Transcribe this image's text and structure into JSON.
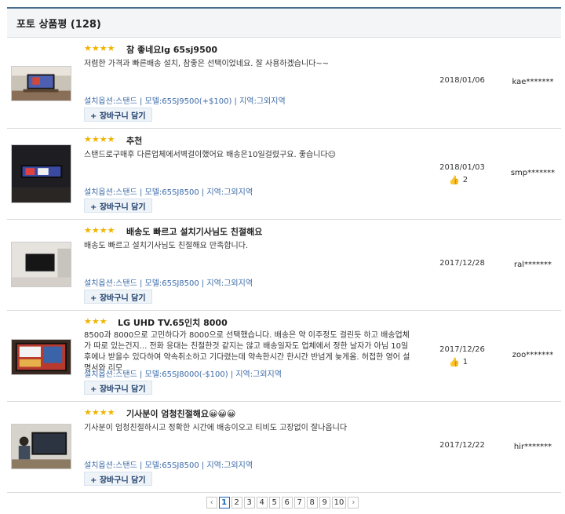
{
  "header": {
    "title": "포토 상품평 (128)"
  },
  "cart_label": "+ 장바구니 담기",
  "reviews": [
    {
      "stars": 4,
      "title": "참 좋네요lg 65sj9500",
      "body": "저렴한 가격과 빠른배송 설치, 참좋은 선택이었네요. 잘 사용하겠습니다~~",
      "options": "설치옵션:스탠드 | 모델:65SJ9500(+$100) | 지역:그외지역",
      "date": "2018/01/06",
      "likes": "",
      "user": "kae*******",
      "thumb": "bright-room-tv"
    },
    {
      "stars": 4,
      "title": "추천",
      "body": "스탠드로구매후 다른업체에서벽걸이했어요 배송은10일걸렸구요. 좋습니다☺",
      "options": "설치옵션:스탠드 | 모델:65SJ8500 | 지역:그외지역",
      "date": "2018/01/03",
      "likes": "2",
      "user": "smp*******",
      "thumb": "dark-room-tv"
    },
    {
      "stars": 4,
      "title": "배송도 빠르고 설치기사님도 친절해요",
      "body": "배송도 빠르고 설치기사님도 친절해요 만족합니다.",
      "options": "설치옵션:스탠드 | 모델:65SJ8500 | 지역:그외지역",
      "date": "2017/12/28",
      "likes": "",
      "user": "ral*******",
      "thumb": "wall-tv"
    },
    {
      "stars": 3,
      "title": "LG UHD TV.65인치 8000",
      "body": "8500과 8000으로 고민하다가 8000으로 선택했습니다. 배송은 약 이주정도 걸린듯 하고 배송업체가 따로 있는건지... 전화 응대는 친절한것 같지는 않고 배송일자도 업체에서 정한 날자가 아님 10일 후에나 받을수 있다하여 약속취소하고 기다렸는데 약속한시간 한시간 반넘게 늦게옴. 허접한 영어 설명서와 리모",
      "options": "설치옵션:스탠드 | 모델:65SJ8000(-$100) | 지역:그외지역",
      "date": "2017/12/26",
      "likes": "1",
      "user": "zoo*******",
      "thumb": "news-tv"
    },
    {
      "stars": 4,
      "title": "기사분이 엄청친절해요😀😀😀",
      "body": "기사분이 엄청친절하시고 정확한 시간에 배송이오고 티비도 고장없이 잘나옵니다",
      "options": "설치옵션:스탠드 | 모델:65SJ8500 | 지역:그외지역",
      "date": "2017/12/22",
      "likes": "",
      "user": "hir*******",
      "thumb": "person-tv"
    }
  ],
  "pagination": {
    "prev": "‹",
    "next": "›",
    "pages": [
      "1",
      "2",
      "3",
      "4",
      "5",
      "6",
      "7",
      "8",
      "9",
      "10"
    ],
    "current": "1"
  },
  "colors": {
    "star": "#f0b400",
    "link": "#3b6aa7",
    "header_border": "#4a6d8c"
  }
}
